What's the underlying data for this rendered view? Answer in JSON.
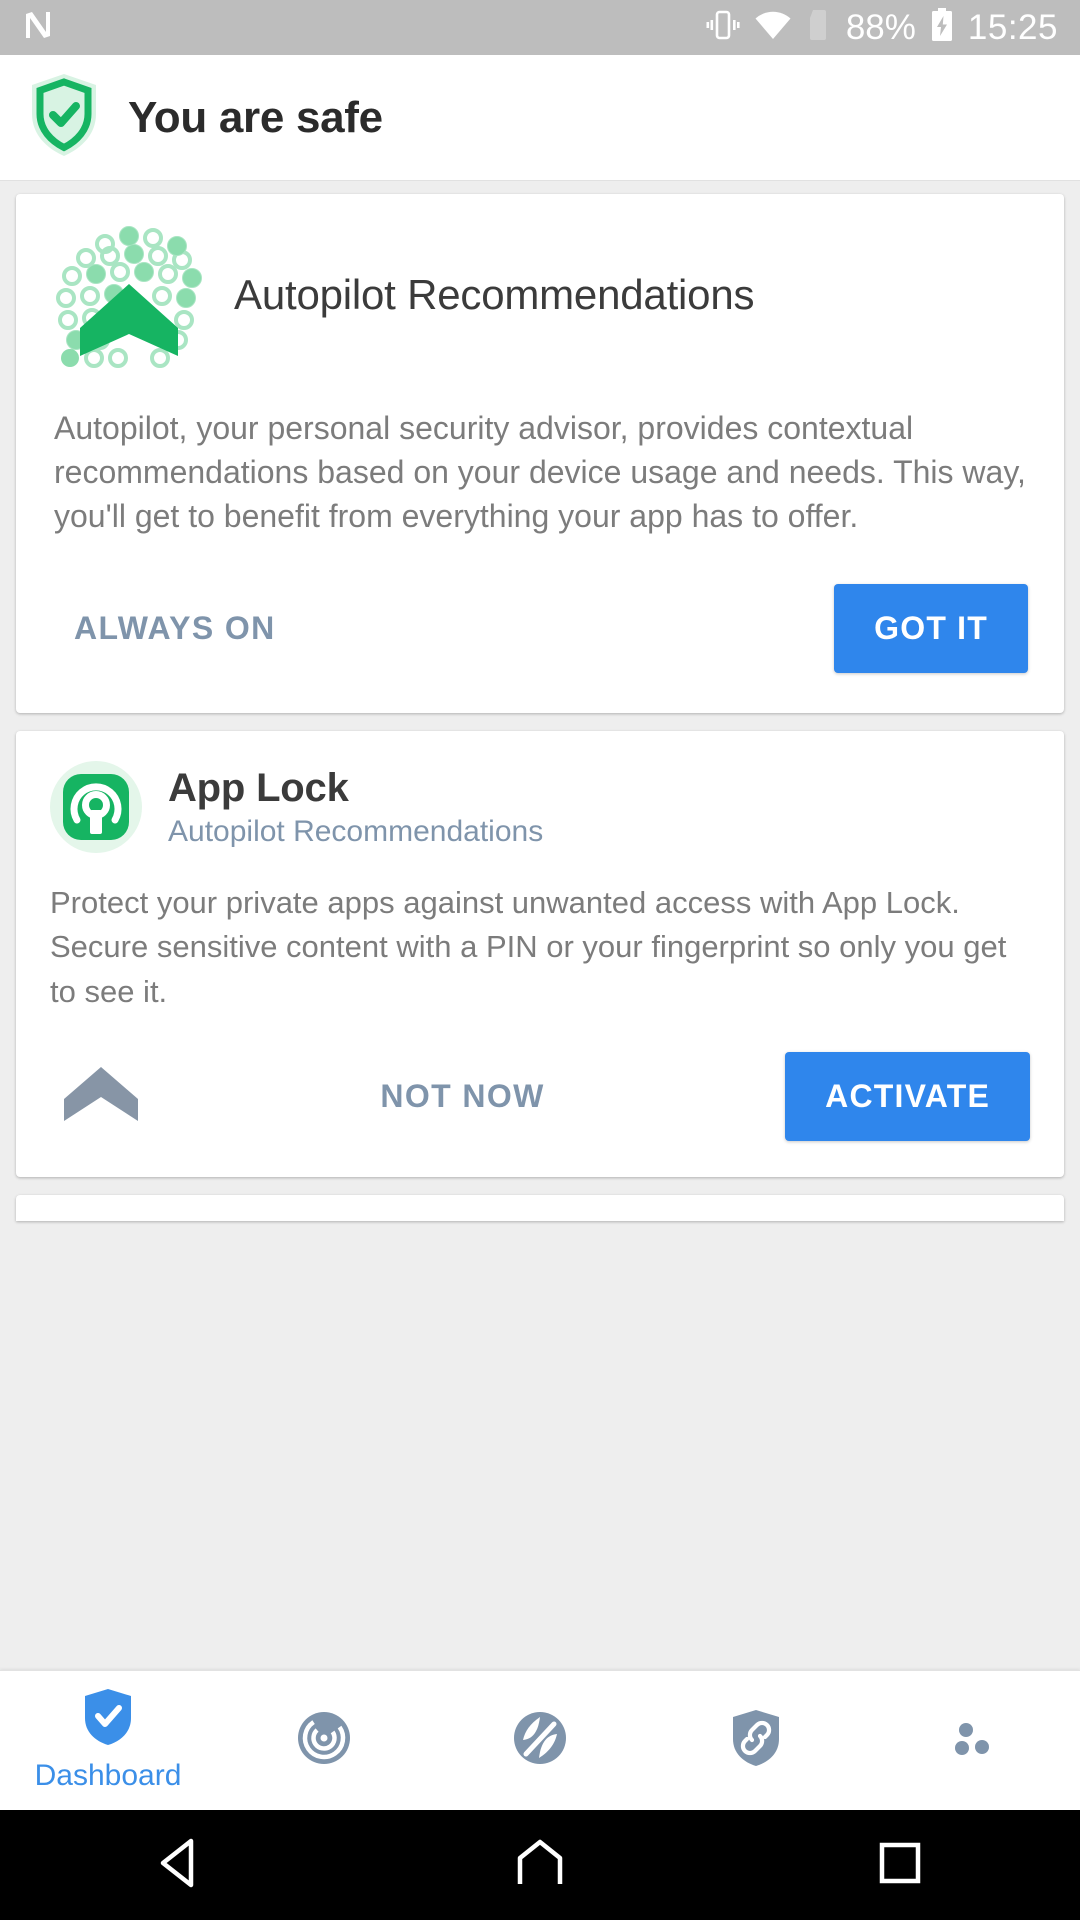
{
  "statusbar": {
    "carrier_icon": "n-logo-icon",
    "vibrate_icon": "vibrate-icon",
    "wifi_icon": "wifi-icon",
    "sim_icon": "no-sim-icon",
    "battery_pct": "88%",
    "battery_icon": "battery-charging-icon",
    "time": "15:25"
  },
  "appbar": {
    "shield_icon": "shield-check-icon",
    "title": "You are safe"
  },
  "autopilot_card": {
    "logo_icon": "autopilot-dots-logo",
    "title": "Autopilot Recommendations",
    "body": "Autopilot, your personal security advisor, provides contextual recommendations based on your device usage and needs. This way, you'll get to benefit from everything your app has to offer.",
    "secondary_action": "ALWAYS ON",
    "primary_action": "GOT IT"
  },
  "applock_card": {
    "icon": "app-lock-icon",
    "title": "App Lock",
    "subtitle": "Autopilot Recommendations",
    "body_line1": "Protect your private apps against unwanted access with App Lock.",
    "body_line2": "Secure sensitive content with a PIN or your fingerprint so only you get to see it.",
    "chevron_icon": "autopilot-chevron-icon",
    "secondary_action": "NOT NOW",
    "primary_action": "ACTIVATE"
  },
  "tabbar": {
    "items": [
      {
        "icon": "shield-check-icon",
        "label": "Dashboard",
        "active": true
      },
      {
        "icon": "scan-target-icon",
        "label": "",
        "active": false
      },
      {
        "icon": "vpn-privacy-icon",
        "label": "",
        "active": false
      },
      {
        "icon": "shield-link-icon",
        "label": "",
        "active": false
      },
      {
        "icon": "more-dots-icon",
        "label": "",
        "active": false
      }
    ]
  },
  "navbar": {
    "back_icon": "back-triangle-icon",
    "home_icon": "home-icon",
    "recents_icon": "recents-square-icon"
  },
  "colors": {
    "accent_blue": "#2f86ec",
    "green": "#16b462",
    "muted_blue": "#7f94ab",
    "body_grey": "#7c7c7c",
    "status_grey": "#bdbdbd"
  }
}
